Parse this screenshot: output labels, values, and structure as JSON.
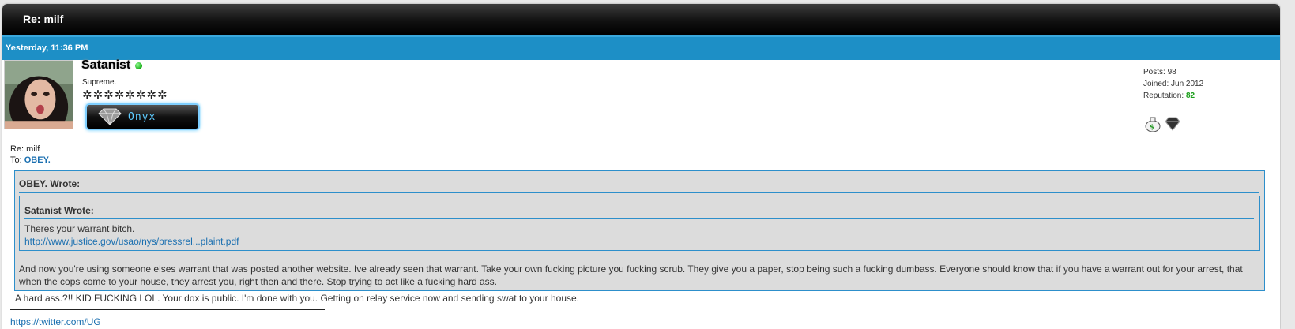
{
  "thread": {
    "title": "Re: milf"
  },
  "post": {
    "date": "Yesterday, 11:36 PM",
    "author": {
      "username": "Satanist",
      "user_title": "Supreme.",
      "stars": "✲✲✲✲✲✲✲✲",
      "rank_badge": "Onyx",
      "online": true
    },
    "stats": {
      "posts_label": "Posts:",
      "posts_value": "98",
      "joined_label": "Joined:",
      "joined_value": "Jun 2012",
      "rep_label": "Reputation:",
      "rep_value": "82"
    },
    "award_icons": [
      "money-bag-icon",
      "diamond-icon"
    ],
    "subject": "Re: milf",
    "to_label": "To:",
    "to_user": "OBEY.",
    "outer_quote": {
      "header": "OBEY. Wrote:",
      "inner_quote": {
        "header": "Satanist Wrote:",
        "text": "Theres your warrant bitch.",
        "link": "http://www.justice.gov/usao/nys/pressrel...plaint.pdf"
      },
      "reply_text": "And now you're using someone elses warrant that was posted another website. Ive already seen that warrant. Take your own fucking picture you fucking scrub. They give you a paper, stop being such a fucking dumbass. Everyone should know that if you have a warrant out for your arrest, that when the cops come to your house, they arrest you, right then and there. Stop trying to act like a fucking hard ass."
    },
    "reply_body": "A hard ass.?!! KID FUCKING LOL. Your dox is public. I'm done with you. Getting on relay service now and sending swat to your house.",
    "signature_link": "https://twitter.com/UG"
  },
  "colors": {
    "date_bar": "#1d8fc6",
    "quote_border": "#2d8fcb",
    "link": "#1a6fb0",
    "reputation": "#1a9e1a"
  }
}
